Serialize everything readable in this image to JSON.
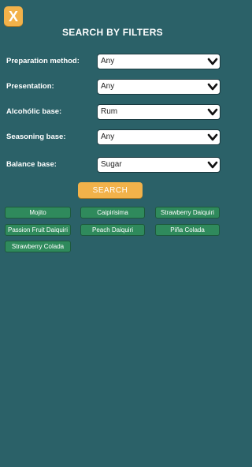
{
  "header": {
    "close_label": "X",
    "title": "SEARCH BY FILTERS"
  },
  "filters": [
    {
      "label": "Preparation method:",
      "value": "Any"
    },
    {
      "label": "Presentation:",
      "value": "Any"
    },
    {
      "label": "Alcohólic base:",
      "value": "Rum"
    },
    {
      "label": "Seasoning base:",
      "value": "Any"
    },
    {
      "label": "Balance base:",
      "value": "Sugar"
    }
  ],
  "search_label": "SEARCH",
  "results": [
    "Mojito",
    "Caipirisima",
    "Strawberry Daiquiri",
    "Passion Fruit Daiquiri",
    "Peach Daiquiri",
    "Piña Colada",
    "Strawberry Colada"
  ],
  "colors": {
    "background": "#2b6168",
    "accent": "#f2b24a",
    "chip": "#2f8a5c"
  }
}
